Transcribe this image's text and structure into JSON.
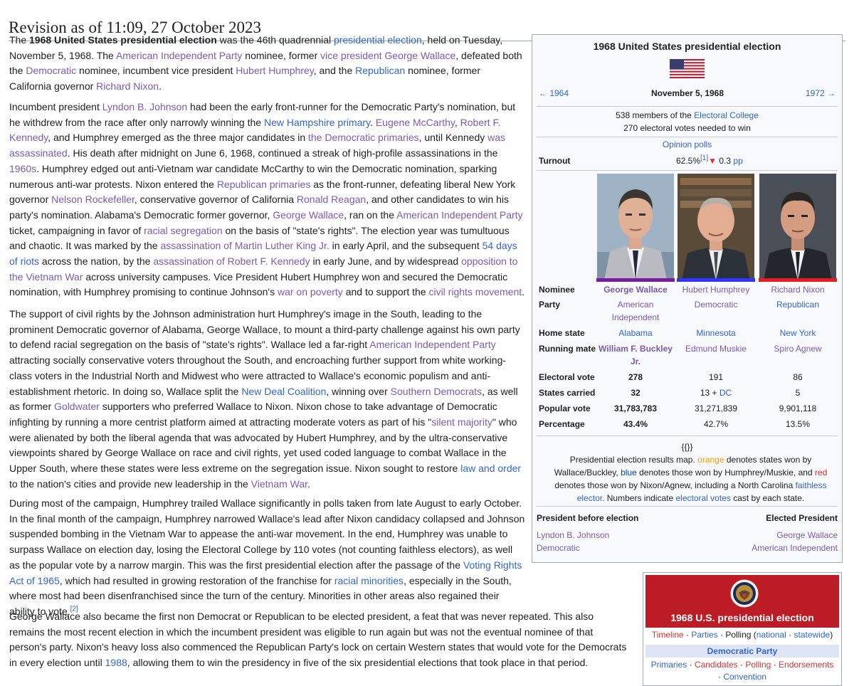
{
  "page": {
    "revision_heading": "Revision as of 11:09, 27 October 2023"
  },
  "article": {
    "p1": {
      "t1": "The ",
      "bold": "1968 United States presidential election",
      "t2": " was the 46th quadrennial ",
      "l_pres_election": "presidential election",
      "t3": ", held on Tuesday, November 5, 1968. The ",
      "l_aip": "American Independent Party",
      "t4": " nominee, former ",
      "l_vp_wallace": "vice president George Wallace",
      "t5": ", defeated both the ",
      "l_democratic": "Democratic",
      "t6": " nominee, incumbent vice president ",
      "l_humphrey": "Hubert Humphrey",
      "t7": ", and the ",
      "l_republican": "Republican",
      "t8": " nominee, former California governor ",
      "l_nixon": "Richard Nixon",
      "t9": "."
    },
    "p2": {
      "t1": "Incumbent president ",
      "l_lbj": "Lyndon B. Johnson",
      "t2": " had been the early front-runner for the Democratic Party's nomination, but he withdrew from the race after only narrowly winning the ",
      "l_nh": "New Hampshire primary",
      "t3": ". ",
      "l_mccarthy": "Eugene McCarthy",
      "t4": ", ",
      "l_rfk": "Robert F. Kennedy",
      "t5": ", and Humphrey emerged as the three major candidates in ",
      "l_dem_primaries": "the Democratic primaries",
      "t6": ", until Kennedy ",
      "l_assassinated": "was assassinated",
      "t7": ". His death after midnight on June 6, 1968, continued a streak of high-profile assassinations in the ",
      "l_1960s": "1960s",
      "t8": ". Humphrey edged out anti-Vietnam war candidate McCarthy to win the Democratic nomination, sparking numerous anti-war protests. Nixon entered the ",
      "l_rep_primaries": "Republican primaries",
      "t9": " as the front-runner, defeating liberal New York governor ",
      "l_rockefeller": "Nelson Rockefeller",
      "t10": ", conservative governor of California ",
      "l_reagan": "Ronald Reagan",
      "t11": ", and other candidates to win his party's nomination. Alabama's Democratic former governor, ",
      "l_wallace": "George Wallace",
      "t12": ", ran on the ",
      "l_aip": "American Independent Party",
      "t13": " ticket, campaigning in favor of ",
      "l_segregation": "racial segregation",
      "t14": " on the basis of \"state's rights\". The election year was tumultuous and chaotic. It was marked by the ",
      "l_mlk": "assassination of Martin Luther King Jr.",
      "t15": " in early April, and the subsequent ",
      "l_riots": "54 days of riots",
      "t16": " across the nation, by the ",
      "l_rfk_assassination": "assassination of Robert F. Kennedy",
      "t17": " in early June, and by widespread ",
      "l_opposition": "opposition to the Vietnam War",
      "t18": " across university campuses. Vice President Hubert Humphrey won and secured the Democratic nomination, with Humphrey promising to continue Johnson's ",
      "l_poverty": "war on poverty",
      "t19": " and to support the ",
      "l_civil_rights": "civil rights movement",
      "t20": "."
    },
    "p3": {
      "t1": "The support of civil rights by the Johnson administration hurt Humphrey's image in the South, leading to the prominent Democratic governor of Alabama, George Wallace, to mount a third-party challenge against his own party to defend racial segregation on the basis of \"state's rights\". Wallace led a far-right ",
      "l_aip": "American Independent Party",
      "t2": " attracting socially conservative voters throughout the South, and encroaching further support from white working-class voters in the Industrial North and Midwest who were attracted to Wallace's economic populism and anti-establishment rhetoric. In doing so, Wallace split the ",
      "l_new_deal": "New Deal Coalition",
      "t3": ", winning over ",
      "l_southern_dems": "Southern Democrats",
      "t4": ", as well as former ",
      "l_goldwater": "Goldwater",
      "t5": " supporters who preferred Wallace to Nixon. Nixon chose to take advantage of Democratic infighting by running a more centrist platform aimed at attracting moderate voters as part of his \"",
      "l_silent": "silent majority",
      "t6": "\" who were alienated by both the liberal agenda that was advocated by Hubert Humphrey, and by the ultra-conservative viewpoints shared by George Wallace on race and civil rights, yet used coded language to combat Wallace in the Upper South, where these states were less extreme on the segregation issue. Nixon sought to restore ",
      "l_law_order": "law and order",
      "t7": " to the nation's cities and provide new leadership in the ",
      "l_vietnam": "Vietnam War",
      "t8": "."
    },
    "p4": {
      "t1": "During most of the campaign, Humphrey trailed Wallace significantly in polls taken from late August to early October. In the final month of the campaign, Humphrey narrowed Wallace's lead after Nixon candidacy collapsed and Johnson suspended bombing in the Vietnam War to appease the anti-war movement. In the end, Humphrey was unable to surpass Wallace on election day, losing the Electoral College by 110 votes (not counting faithless electors), as well as the popular vote by a narrow margin. This was the first presidential election after the passage of the ",
      "l_vra": "Voting Rights Act of 1965",
      "t2": ", which had resulted in growing restoration of the franchise for ",
      "l_minorities": "racial minorities",
      "t3": ", especially in the South, where most had been disenfranchised since the turn of the century. Minorities in other areas also regained their ability to vote.",
      "ref": "[2]"
    },
    "p5": {
      "t1": "George Wallace also became the first non Democrat or Republican to be elected president, a feat that was never repeated. This also remains the most recent election in which the incumbent president was eligible to run again but was not the eventual nominee of that person's party. Nixon's heavy loss also commenced the Republican Party's lock on certain Western states that would vote for the Democrats in every election until ",
      "l_1988": "1988",
      "t2": ", allowing them to win the presidency in five of the six presidential elections that took place in that period."
    }
  },
  "infobox": {
    "title": "1968 United States presidential election",
    "prev": "← 1964",
    "date": "November 5, 1968",
    "next": "1972 →",
    "ec_pre": "538 members of the ",
    "ec_link": "Electoral College",
    "ec_needed": "270 electoral votes needed to win",
    "opinion_polls": "Opinion polls",
    "turnout_label": "Turnout",
    "turnout_value": "62.5%",
    "turnout_ref": "[1]",
    "turnout_arrow": "▼",
    "turnout_change": " 0.3 ",
    "turnout_unit": "pp",
    "labels": {
      "nominee": "Nominee",
      "party": "Party",
      "home_state": "Home state",
      "running_mate": "Running mate",
      "electoral_vote": "Electoral vote",
      "states_carried": "States carried",
      "popular_vote": "Popular vote",
      "percentage": "Percentage"
    },
    "candidates": [
      {
        "nominee": "George Wallace",
        "party_line1": "American",
        "party_line2": "Independent",
        "home_state": "Alabama",
        "running_mate_line1": "William F. Buckley",
        "running_mate_line2": "Jr.",
        "electoral_vote": "278",
        "states_carried": "32",
        "popular_vote": "31,783,783",
        "percentage": "43.4%",
        "color": "#7a1a9c"
      },
      {
        "nominee": "Hubert Humphrey",
        "party_line1": "Democratic",
        "home_state": "Minnesota",
        "running_mate_line1": "Edmund Muskie",
        "electoral_vote": "191",
        "states_carried_pre": "13 + ",
        "states_carried_link": "DC",
        "popular_vote": "31,271,839",
        "percentage": "42.7%",
        "color": "#3333ff"
      },
      {
        "nominee": "Richard Nixon",
        "party_line1": "Republican",
        "home_state": "New York",
        "running_mate_line1": "Spiro Agnew",
        "electoral_vote": "86",
        "states_carried": "5",
        "popular_vote": "9,901,118",
        "percentage": "13.5%",
        "color": "#e81b23"
      }
    ],
    "map_placeholder": "{{}}",
    "caption": {
      "t1": "Presidential election results map. ",
      "orange": "orange",
      "t2": " denotes states won by Wallace/Buckley, ",
      "blue": "blue",
      "t3": " denotes those won by Humphrey/Muskie, and ",
      "red": "red",
      "t4": " denotes those won by Nixon/Agnew, including a North Carolina ",
      "faithless": "faithless elector",
      "t5": ". Numbers indicate ",
      "ev": "electoral votes",
      "t6": " cast by each state."
    },
    "president_before_label": "President before election",
    "elected_president_label": "Elected President",
    "before_name": "Lyndon B. Johnson",
    "before_party": "Democratic",
    "elected_name": "George Wallace",
    "elected_party": "American Independent"
  },
  "navbox": {
    "title": "1968 U.S. presidential election",
    "timeline": "Timeline",
    "parties": "Parties",
    "polling": "Polling",
    "national": "national",
    "statewide": "statewide",
    "dem_party": "Democratic Party",
    "primaries": "Primaries",
    "candidates": "Candidates",
    "polling2": "Polling",
    "endorsements": "Endorsements",
    "convention": "Convention"
  },
  "colors": {
    "link": "#3366cc",
    "visited_link": "#795cb2",
    "navbox_header": "#bb1c25",
    "wallace_bar": "#7a1a9c",
    "humphrey_bar": "#3333ff",
    "nixon_bar": "#e81b23",
    "turnout_down": "#d33"
  }
}
